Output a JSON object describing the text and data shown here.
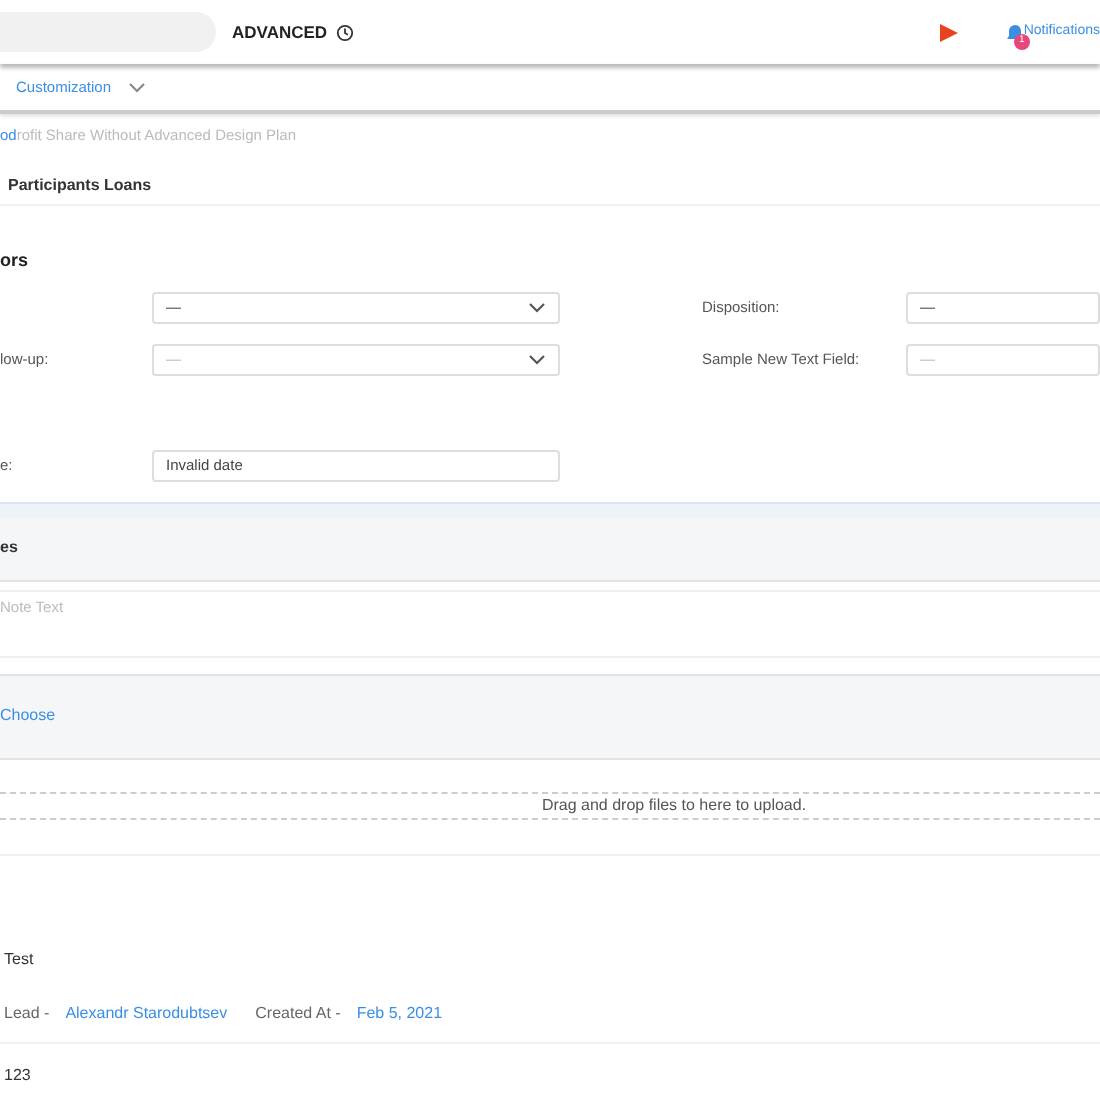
{
  "header": {
    "title": "ADVANCED",
    "notifications": {
      "label": "Notifications",
      "count": "1"
    }
  },
  "nav": {
    "label": "Customization"
  },
  "breadcrumb": {
    "link": "od",
    "text": "rofit Share Without Advanced Design Plan"
  },
  "tab": {
    "label": "Participants Loans"
  },
  "section_title": "ors",
  "form_rows": [
    [
      {
        "kind": "select",
        "value": "—"
      },
      {
        "kind": "input",
        "label": "Disposition:",
        "value": "—"
      }
    ],
    [
      {
        "kind": "select",
        "label": "low-up:",
        "placeholder": "—"
      },
      {
        "kind": "input",
        "label": "Sample New Text Field:",
        "placeholder": "—"
      }
    ],
    [
      {
        "kind": "input",
        "label": "e:",
        "value": "Invalid date"
      }
    ]
  ],
  "notes": {
    "title": "es",
    "placeholder": "Note Text"
  },
  "attachments": {
    "link": "Choose",
    "dropzone": "Drag and drop files to here to upload."
  },
  "note_item": {
    "text": "Test",
    "lead_label": "Lead -",
    "lead": "Alexandr Starodubtsev",
    "created_label": "Created At -",
    "created": "Feb 5, 2021"
  },
  "footer_text": "123"
}
